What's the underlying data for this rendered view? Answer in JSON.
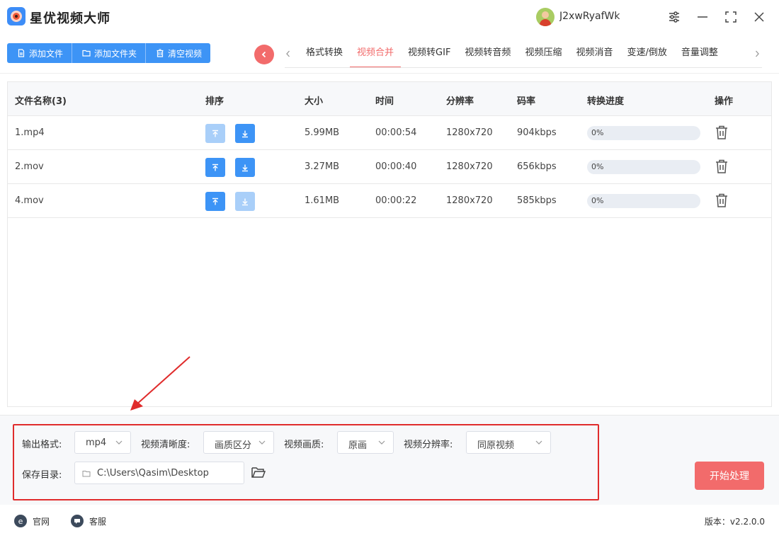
{
  "app": {
    "title": "星优视频大师"
  },
  "user": {
    "name": "J2xwRyafWk"
  },
  "toolbar": {
    "add_file": "添加文件",
    "add_folder": "添加文件夹",
    "clear_videos": "清空视频"
  },
  "tabs": [
    {
      "label": "格式转换",
      "active": false
    },
    {
      "label": "视频合并",
      "active": true
    },
    {
      "label": "视频转GIF",
      "active": false
    },
    {
      "label": "视频转音频",
      "active": false
    },
    {
      "label": "视频压缩",
      "active": false
    },
    {
      "label": "视频消音",
      "active": false
    },
    {
      "label": "变速/倒放",
      "active": false
    },
    {
      "label": "音量调整",
      "active": false
    }
  ],
  "table": {
    "headers": {
      "name": "文件名称(3)",
      "sort": "排序",
      "size": "大小",
      "time": "时间",
      "resolution": "分辨率",
      "bitrate": "码率",
      "progress": "转换进度",
      "actions": "操作"
    },
    "rows": [
      {
        "name": "1.mp4",
        "size": "5.99MB",
        "time": "00:00:54",
        "resolution": "1280x720",
        "bitrate": "904kbps",
        "progress": "0%",
        "progress_value": 0,
        "up_enabled": false,
        "down_enabled": true
      },
      {
        "name": "2.mov",
        "size": "3.27MB",
        "time": "00:00:40",
        "resolution": "1280x720",
        "bitrate": "656kbps",
        "progress": "0%",
        "progress_value": 0,
        "up_enabled": true,
        "down_enabled": true
      },
      {
        "name": "4.mov",
        "size": "1.61MB",
        "time": "00:00:22",
        "resolution": "1280x720",
        "bitrate": "585kbps",
        "progress": "0%",
        "progress_value": 0,
        "up_enabled": true,
        "down_enabled": false
      }
    ]
  },
  "settings": {
    "output_format_label": "输出格式:",
    "output_format_value": "mp4",
    "clarity_label": "视频清晰度:",
    "clarity_value": "画质区分",
    "quality_label": "视频画质:",
    "quality_value": "原画",
    "resolution_label": "视频分辨率:",
    "resolution_value": "同原视频",
    "save_dir_label": "保存目录:",
    "save_dir_value": "C:\\Users\\Qasim\\Desktop",
    "start_button": "开始处理"
  },
  "statusbar": {
    "website": "官网",
    "support": "客服",
    "version": "版本：v2.2.0.0"
  },
  "colors": {
    "accent_blue": "#3d94f6",
    "accent_red": "#f26b6b",
    "highlight_box": "#e02c2c"
  }
}
